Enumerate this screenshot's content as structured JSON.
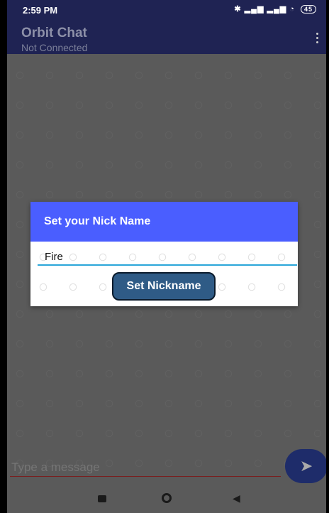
{
  "status": {
    "time": "2:59 PM",
    "battery": "45"
  },
  "app": {
    "title": "Orbit Chat",
    "subtitle": "Not Connected"
  },
  "dialog": {
    "title": "Set your Nick Name",
    "nickname_value": "Fire",
    "button_label": "Set Nickname"
  },
  "composer": {
    "placeholder": "Type a message"
  },
  "icons": {
    "menu": "more-vert-icon",
    "send": "send-icon",
    "recents": "recents-icon",
    "home": "home-icon",
    "back": "back-icon"
  }
}
